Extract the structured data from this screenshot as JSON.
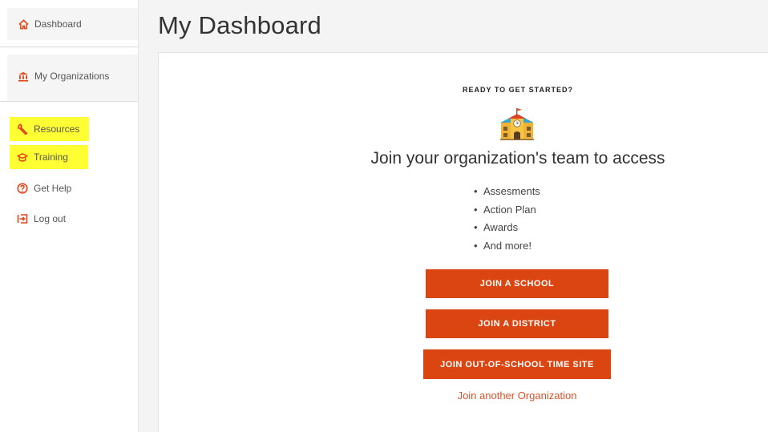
{
  "sidebar": {
    "items": [
      {
        "label": "Dashboard",
        "icon": "home-icon"
      },
      {
        "label": "My Organizations",
        "icon": "building-icon"
      },
      {
        "label": "Resources",
        "icon": "wrench-icon"
      },
      {
        "label": "Training",
        "icon": "graduation-cap-icon"
      },
      {
        "label": "Get Help",
        "icon": "help-icon"
      },
      {
        "label": "Log out",
        "icon": "logout-icon"
      }
    ],
    "highlight_color": "#ffff33",
    "icon_color": "#e0461a"
  },
  "main": {
    "title": "My Dashboard",
    "ready_text": "READY TO GET STARTED?",
    "heading": "Join your organization's team to access",
    "bullets": [
      "Assesments",
      "Action Plan",
      "Awards",
      "And more!"
    ],
    "buttons": {
      "join_school": "JOIN A SCHOOL",
      "join_district": "JOIN A DISTRICT",
      "join_ost": "JOIN OUT-OF-SCHOOL TIME SITE"
    },
    "link": "Join another Organization",
    "accent_color": "#db4512"
  }
}
